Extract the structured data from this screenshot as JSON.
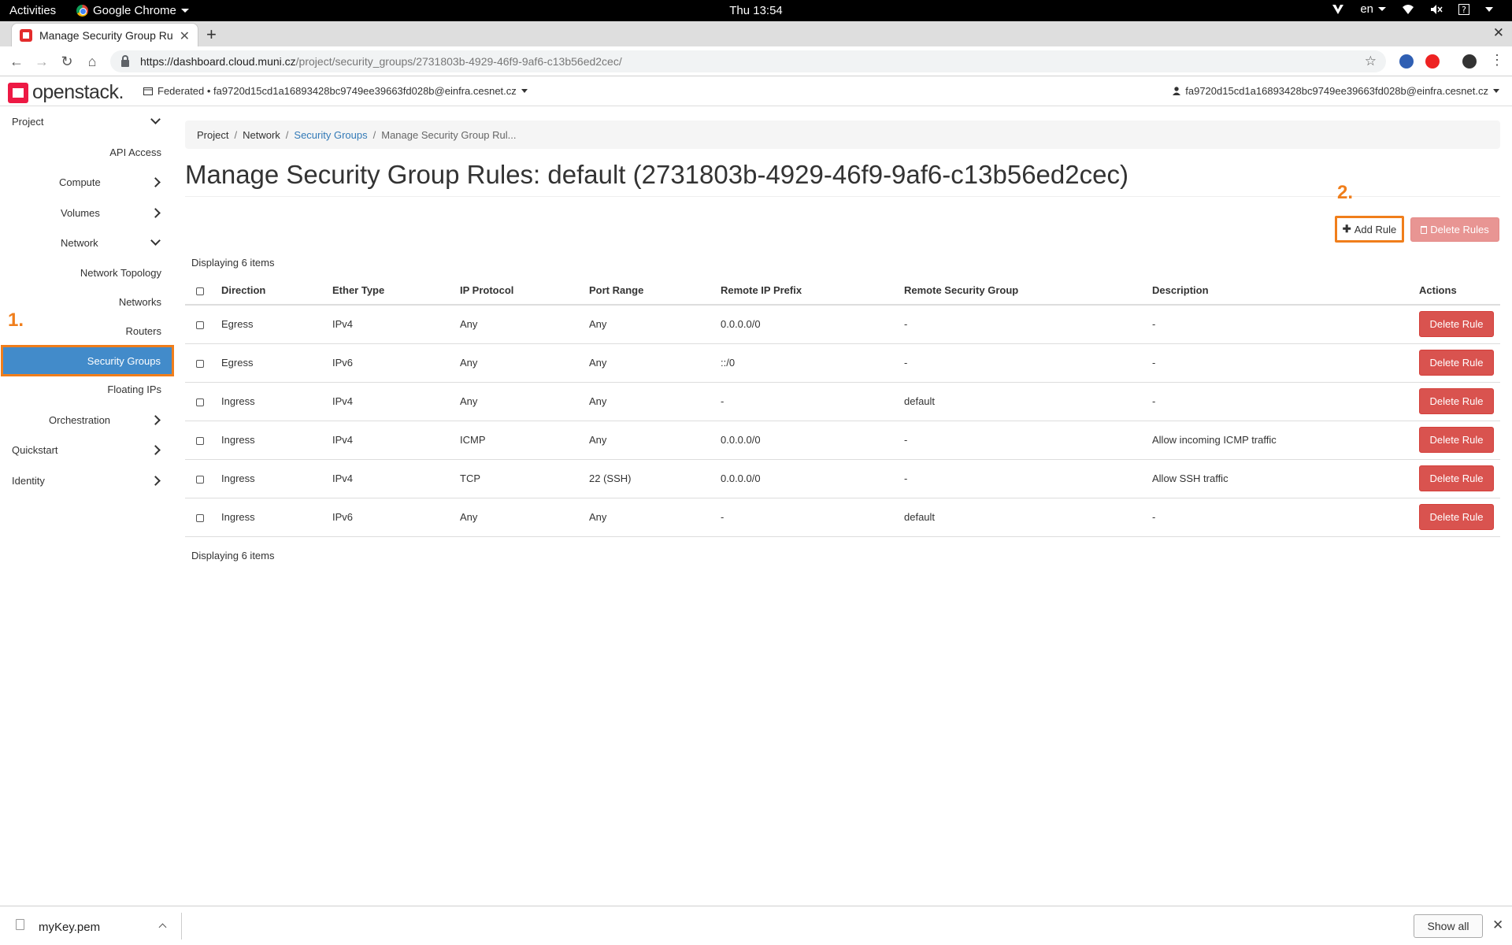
{
  "os_bar": {
    "activities": "Activities",
    "app_name": "Google Chrome",
    "clock": "Thu 13:54",
    "lang": "en"
  },
  "browser": {
    "tab_title": "Manage Security Group Ru",
    "url_host": "https://dashboard.cloud.muni.cz",
    "url_path": "/project/security_groups/2731803b-4929-46f9-9af6-c13b56ed2cec/"
  },
  "header": {
    "logo": "openstack.",
    "project": "Federated • fa9720d15cd1a16893428bc9749ee39663fd028b@einfra.cesnet.cz",
    "user": "fa9720d15cd1a16893428bc9749ee39663fd028b@einfra.cesnet.cz"
  },
  "sidebar": {
    "project": "Project",
    "api_access": "API Access",
    "compute": "Compute",
    "volumes": "Volumes",
    "network": "Network",
    "network_topology": "Network Topology",
    "networks": "Networks",
    "routers": "Routers",
    "security_groups": "Security Groups",
    "floating_ips": "Floating IPs",
    "orchestration": "Orchestration",
    "quickstart": "Quickstart",
    "identity": "Identity"
  },
  "annotations": {
    "step1": "1.",
    "step2": "2."
  },
  "breadcrumb": {
    "project": "Project",
    "network": "Network",
    "security_groups": "Security Groups",
    "current": "Manage Security Group Rul..."
  },
  "page": {
    "title": "Manage Security Group Rules: default (2731803b-4929-46f9-9af6-c13b56ed2cec)",
    "add_rule": "Add Rule",
    "delete_rules": "Delete Rules",
    "displaying": "Displaying 6 items"
  },
  "table": {
    "headers": [
      "Direction",
      "Ether Type",
      "IP Protocol",
      "Port Range",
      "Remote IP Prefix",
      "Remote Security Group",
      "Description",
      "Actions"
    ],
    "delete_label": "Delete Rule",
    "rows": [
      [
        "Egress",
        "IPv4",
        "Any",
        "Any",
        "0.0.0.0/0",
        "-",
        "-"
      ],
      [
        "Egress",
        "IPv6",
        "Any",
        "Any",
        "::/0",
        "-",
        "-"
      ],
      [
        "Ingress",
        "IPv4",
        "Any",
        "Any",
        "-",
        "default",
        "-"
      ],
      [
        "Ingress",
        "IPv4",
        "ICMP",
        "Any",
        "0.0.0.0/0",
        "-",
        "Allow incoming ICMP traffic"
      ],
      [
        "Ingress",
        "IPv4",
        "TCP",
        "22 (SSH)",
        "0.0.0.0/0",
        "-",
        "Allow SSH traffic"
      ],
      [
        "Ingress",
        "IPv6",
        "Any",
        "Any",
        "-",
        "default",
        "-"
      ]
    ]
  },
  "downloads": {
    "file": "myKey.pem",
    "show_all": "Show all"
  },
  "colors": {
    "accent": "#f07e1b",
    "active_nav": "#428bca",
    "danger": "#d9534f",
    "brand": "#ed1944"
  }
}
